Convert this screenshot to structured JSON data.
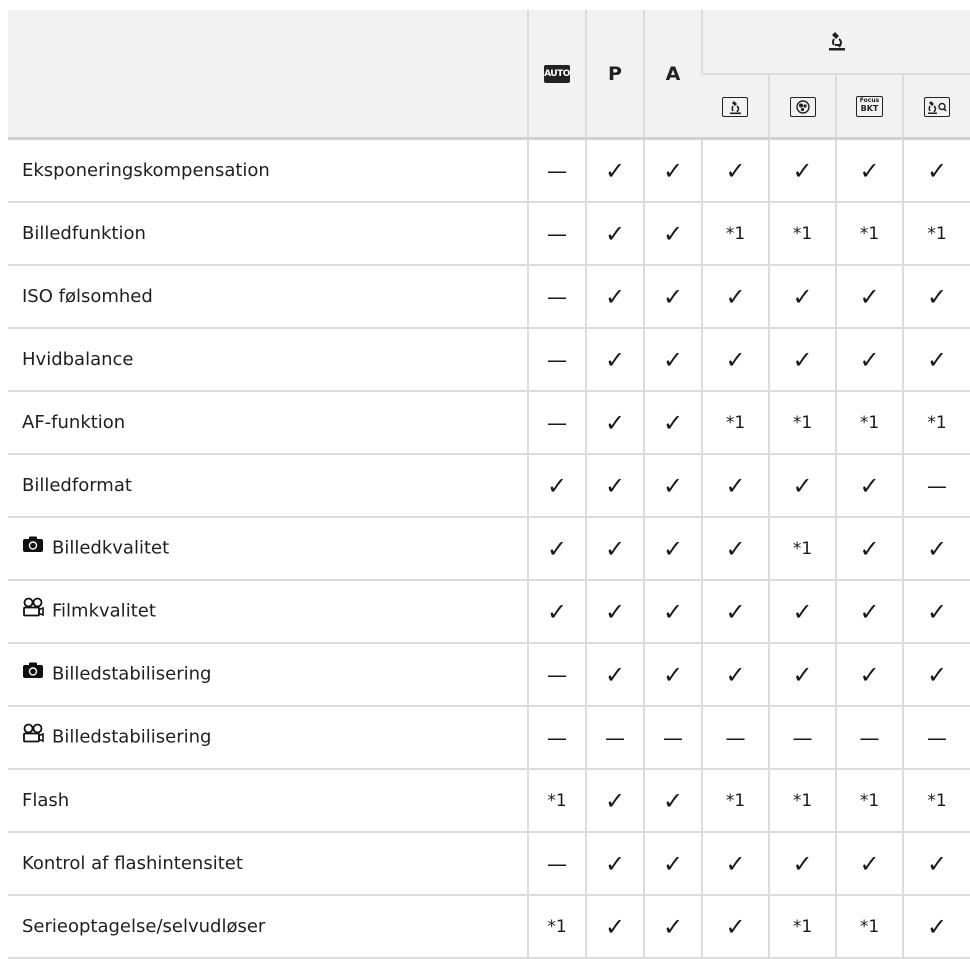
{
  "header": {
    "auto_icon_text": "AUTO",
    "col_p": "P",
    "col_a": "A",
    "micro_group_icon": "microscope-icon",
    "micro_columns": [
      {
        "icon": "microscope-mode-icon"
      },
      {
        "icon": "microscope-hdr-icon"
      },
      {
        "icon": "focus-bkt-icon",
        "line1": "Focus",
        "line2": "BKT"
      },
      {
        "icon": "microscope-magnify-icon"
      }
    ]
  },
  "rows": [
    {
      "label": "Eksponeringskompensation",
      "icon": "",
      "cells": [
        "—",
        "✓",
        "✓",
        "✓",
        "✓",
        "✓",
        "✓"
      ]
    },
    {
      "label": "Billedfunktion",
      "icon": "",
      "cells": [
        "—",
        "✓",
        "✓",
        "*1",
        "*1",
        "*1",
        "*1"
      ]
    },
    {
      "label": "ISO følsomhed",
      "icon": "",
      "cells": [
        "—",
        "✓",
        "✓",
        "✓",
        "✓",
        "✓",
        "✓"
      ]
    },
    {
      "label": "Hvidbalance",
      "icon": "",
      "cells": [
        "—",
        "✓",
        "✓",
        "✓",
        "✓",
        "✓",
        "✓"
      ]
    },
    {
      "label": "AF-funktion",
      "icon": "",
      "cells": [
        "—",
        "✓",
        "✓",
        "*1",
        "*1",
        "*1",
        "*1"
      ]
    },
    {
      "label": "Billedformat",
      "icon": "",
      "cells": [
        "✓",
        "✓",
        "✓",
        "✓",
        "✓",
        "✓",
        "—"
      ]
    },
    {
      "label": "Billedkvalitet",
      "icon": "camera-icon",
      "cells": [
        "✓",
        "✓",
        "✓",
        "✓",
        "*1",
        "✓",
        "✓"
      ]
    },
    {
      "label": "Filmkvalitet",
      "icon": "movie-icon",
      "cells": [
        "✓",
        "✓",
        "✓",
        "✓",
        "✓",
        "✓",
        "✓"
      ]
    },
    {
      "label": "Billedstabilisering",
      "icon": "camera-icon",
      "cells": [
        "—",
        "✓",
        "✓",
        "✓",
        "✓",
        "✓",
        "✓"
      ]
    },
    {
      "label": "Billedstabilisering",
      "icon": "movie-icon",
      "cells": [
        "—",
        "—",
        "—",
        "—",
        "—",
        "—",
        "—"
      ]
    },
    {
      "label": "Flash",
      "icon": "",
      "cells": [
        "*1",
        "✓",
        "✓",
        "*1",
        "*1",
        "*1",
        "*1"
      ]
    },
    {
      "label": "Kontrol af flashintensitet",
      "icon": "",
      "cells": [
        "—",
        "✓",
        "✓",
        "✓",
        "✓",
        "✓",
        "✓"
      ]
    },
    {
      "label": "Serieoptagelse/selvudløser",
      "icon": "",
      "cells": [
        "*1",
        "✓",
        "✓",
        "✓",
        "*1",
        "*1",
        "✓"
      ]
    }
  ]
}
